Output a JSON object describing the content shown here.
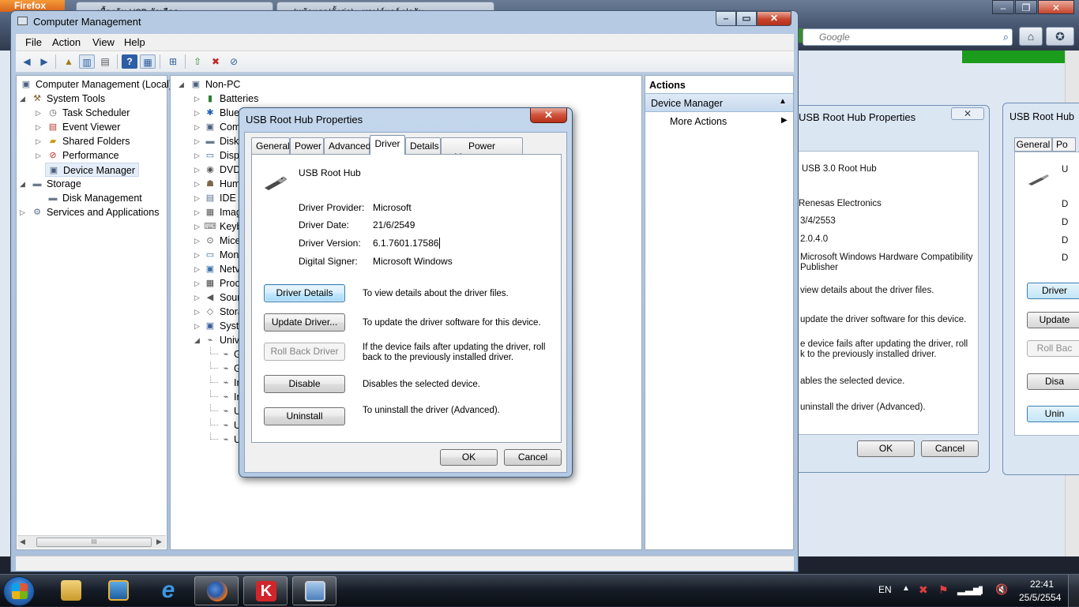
{
  "firefox": {
    "menu_label": "Firefox",
    "tab1": "เบื้องต้น USB ตัวเลือก",
    "tab2": "(หน้าแรก/ตั้งค่า) - ซอฟต์แวร์ ฟอรัม",
    "search_placeholder": "Google"
  },
  "bg_dialog1": {
    "title": "USB Root Hub Properties",
    "device": "USB 3.0 Root Hub",
    "provider": "Renesas Electronics",
    "date": "3/4/2553",
    "version": "2.0.4.0",
    "signer_line1": "Microsoft Windows Hardware Compatibility",
    "signer_line2": "Publisher",
    "desc1": "view details about the driver files.",
    "desc2": "update the driver software for this device.",
    "desc3_line1": "e device fails after updating the driver, roll",
    "desc3_line2": "k to the previously installed driver.",
    "desc4": "ables the selected device.",
    "desc5": "uninstall the driver (Advanced).",
    "ok": "OK",
    "cancel": "Cancel"
  },
  "bg_dialog2": {
    "title": "USB Root Hub",
    "tab_general": "General",
    "tab_po": "Po",
    "btn_driver": "Driver",
    "btn_update": "Update",
    "btn_rollback": "Roll Bac",
    "btn_disable": "Disa",
    "btn_uninstall": "Unin",
    "letters": [
      "U",
      "D",
      "D",
      "D",
      "D"
    ]
  },
  "cm": {
    "title": "Computer Management",
    "menu": [
      "File",
      "Action",
      "View",
      "Help"
    ],
    "tree": {
      "root": "Computer Management (Local)",
      "system_tools": "System Tools",
      "task_scheduler": "Task Scheduler",
      "event_viewer": "Event Viewer",
      "shared_folders": "Shared Folders",
      "performance": "Performance",
      "device_manager": "Device Manager",
      "storage": "Storage",
      "disk_management": "Disk Management",
      "services": "Services and Applications"
    },
    "devices": {
      "root": "Non-PC",
      "items": [
        "Batteries",
        "Blue",
        "Com",
        "Disk",
        "Disp",
        "DVD",
        "Hum",
        "IDE A",
        "Imag",
        "Keyb",
        "Mice",
        "Mon",
        "Netv",
        "Proc",
        "Sour",
        "Stora",
        "Syste",
        "Univ"
      ],
      "sub_items": [
        "G",
        "G",
        "In",
        "In",
        "U",
        "U",
        "U"
      ]
    },
    "actions": {
      "header": "Actions",
      "section": "Device Manager",
      "more": "More Actions"
    },
    "hscroll_grip": "III"
  },
  "dialog": {
    "title": "USB Root Hub Properties",
    "tabs": [
      "General",
      "Power",
      "Advanced",
      "Driver",
      "Details",
      "Power Management"
    ],
    "active_tab": "Driver",
    "device_name": "USB Root Hub",
    "fields": {
      "provider_label": "Driver Provider:",
      "provider_value": "Microsoft",
      "date_label": "Driver Date:",
      "date_value": "21/6/2549",
      "version_label": "Driver Version:",
      "version_value": "6.1.7601.17586",
      "signer_label": "Digital Signer:",
      "signer_value": "Microsoft Windows"
    },
    "buttons": {
      "details": "Driver Details",
      "update": "Update Driver...",
      "rollback": "Roll Back Driver",
      "disable": "Disable",
      "uninstall": "Uninstall"
    },
    "descriptions": {
      "details": "To view details about the driver files.",
      "update": "To update the driver software for this device.",
      "rollback_line1": "If the device fails after updating the driver, roll",
      "rollback_line2": "back to the previously installed driver.",
      "disable": "Disables the selected device.",
      "uninstall": "To uninstall the driver (Advanced)."
    },
    "ok": "OK",
    "cancel": "Cancel"
  },
  "taskbar": {
    "language": "EN",
    "time": "22:41",
    "date": "25/5/2554"
  },
  "colors": {
    "accent_blue": "#3c7fb1",
    "close_red": "#c8432b",
    "firefox_orange": "#e07a28",
    "progress_green": "#1c9c1c"
  }
}
